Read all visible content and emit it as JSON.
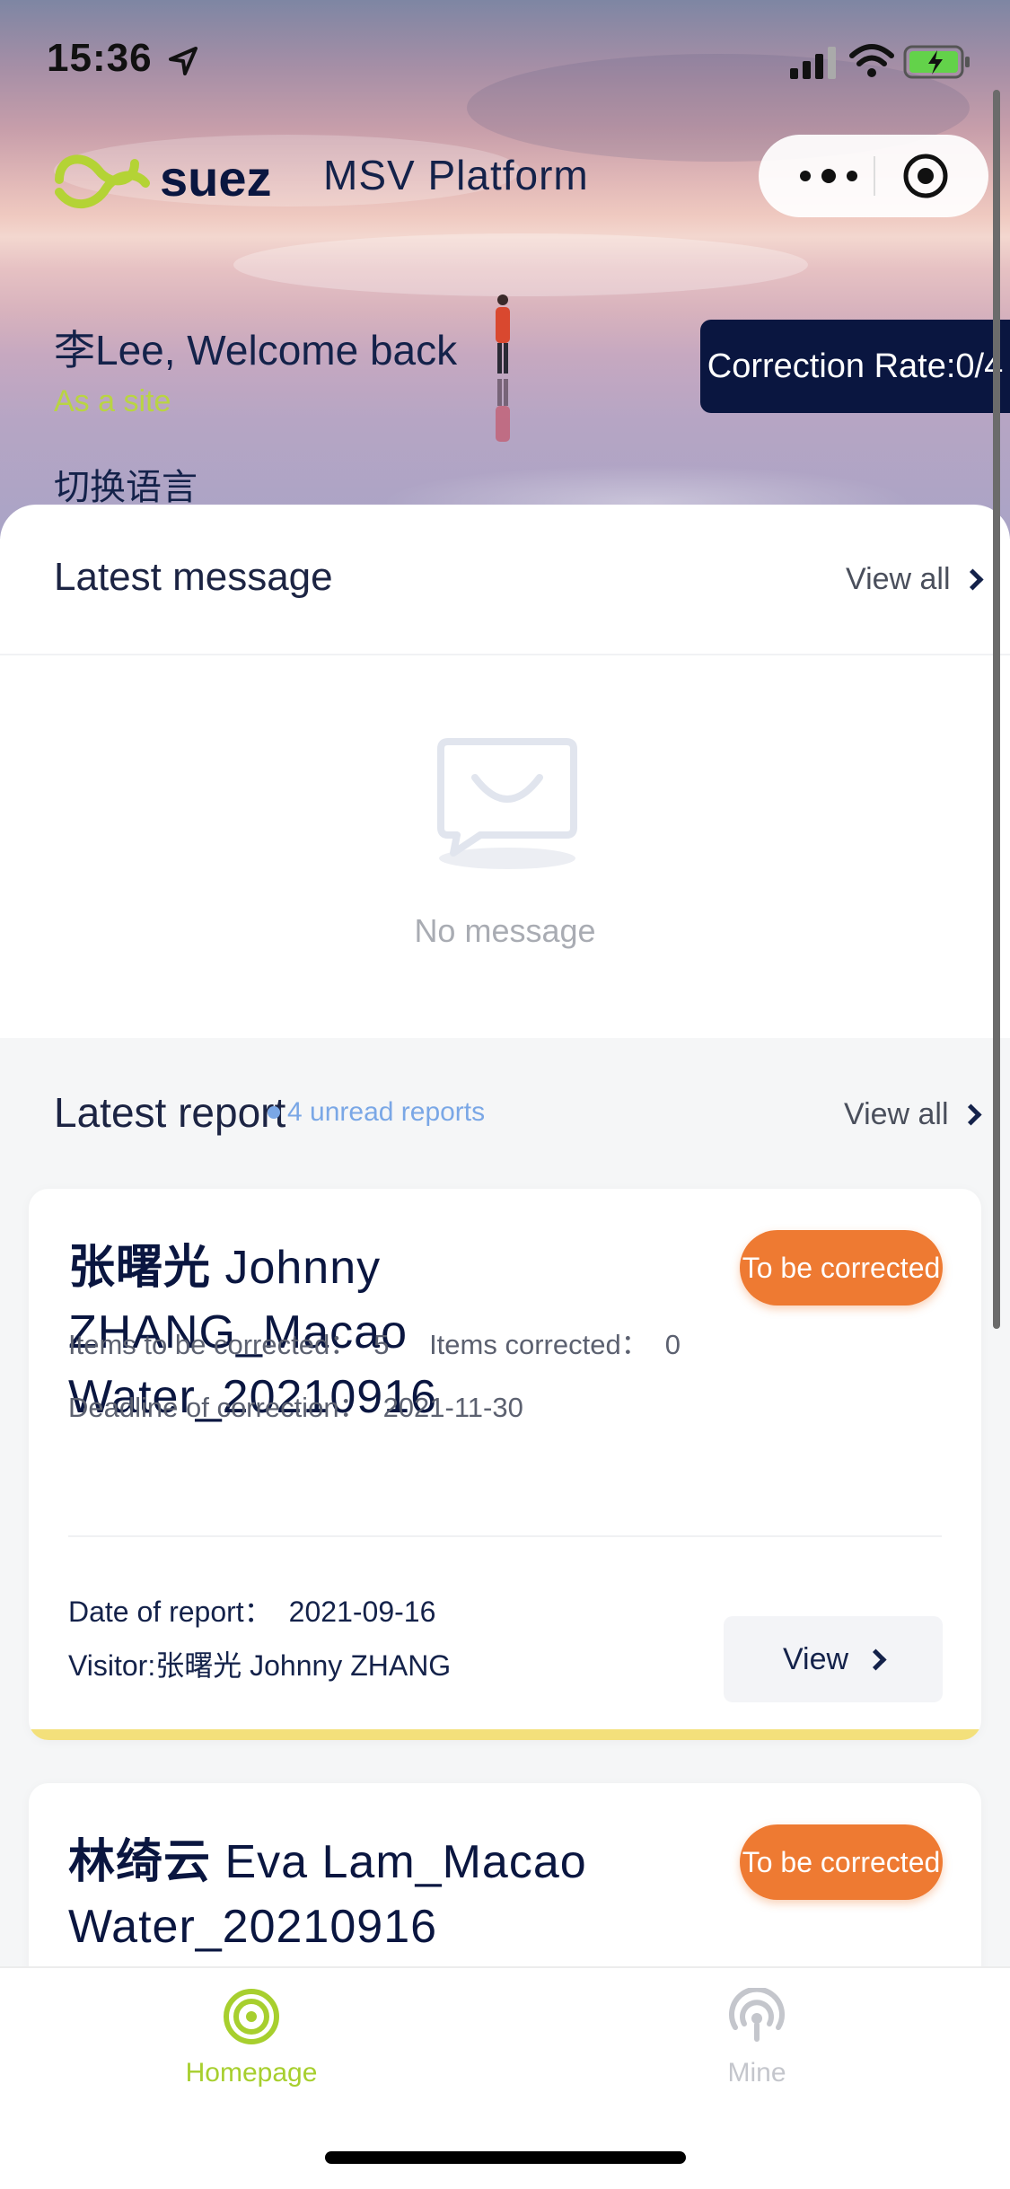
{
  "status_bar": {
    "time": "15:36"
  },
  "header": {
    "platform_title": "MSV Platform",
    "greeting": "李Lee, Welcome back",
    "role": "As a site",
    "language_switch": "切换语言",
    "correction_rate": "Correction Rate:0/4"
  },
  "messages": {
    "title": "Latest message",
    "view_all": "View all",
    "empty_text": "No message"
  },
  "reports": {
    "title": "Latest report",
    "unread": "4 unread reports",
    "view_all": "View all",
    "items": [
      {
        "name_cn": "张曙光",
        "name_en": " Johnny ZHANG_Macao Water_20210916",
        "status": "To be corrected",
        "items_to_correct_label": "Items to be corrected：",
        "items_to_correct": "5",
        "items_corrected_label": "Items corrected：",
        "items_corrected": "0",
        "deadline_label": "Deadline of correction：",
        "deadline": "2021-11-30",
        "date_label": "Date of report：",
        "date": "2021-09-16",
        "visitor": "Visitor:张曙光 Johnny ZHANG",
        "view_label": "View"
      },
      {
        "name_cn": "林绮云",
        "name_en": " Eva Lam_Macao Water_20210916",
        "status": "To be corrected"
      }
    ]
  },
  "tabbar": {
    "home": "Homepage",
    "mine": "Mine",
    "active_color": "#a7cf2e",
    "inactive_color": "#c4c6cc"
  }
}
